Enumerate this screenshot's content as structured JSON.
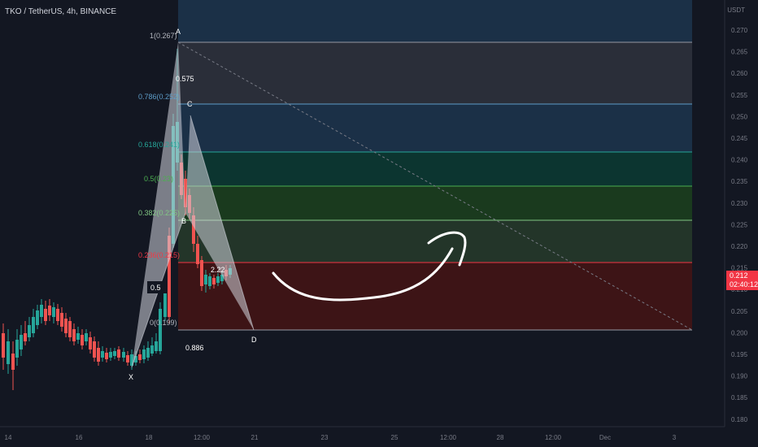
{
  "header": {
    "title": "TKO / TetherUS, 4h, BINANCE"
  },
  "price_axis": {
    "unit": "USDT",
    "ticks": [
      "0.270",
      "0.265",
      "0.260",
      "0.255",
      "0.250",
      "0.245",
      "0.240",
      "0.235",
      "0.230",
      "0.225",
      "0.220",
      "0.215",
      "0.210",
      "0.205",
      "0.200",
      "0.195",
      "0.190",
      "0.185",
      "0.180"
    ]
  },
  "time_axis": {
    "ticks": [
      "14",
      "16",
      "18",
      "12:00",
      "21",
      "23",
      "25",
      "12:00",
      "28",
      "12:00",
      "Dec",
      "3"
    ]
  },
  "last_price": {
    "value": "0.212",
    "countdown": "02:40:12"
  },
  "fib_levels": [
    {
      "label": "1(0.267)",
      "color": "#9598a1",
      "fill": "#2a2e39"
    },
    {
      "label": "0.786(0.252)",
      "color": "#5d9cc8",
      "fill": "#1b3047"
    },
    {
      "label": "0.618(0.241)",
      "color": "#26a69a",
      "fill": "#0c3530"
    },
    {
      "label": "0.5(0.23)",
      "color": "#4caf50",
      "fill": "#1a3a1e"
    },
    {
      "label": "0.382(0.225)",
      "color": "#81c784",
      "fill": "#233529"
    },
    {
      "label": "0.236(0.215)",
      "color": "#f23645",
      "fill": "#3d1416"
    },
    {
      "label": "0(0.199)",
      "color": "#9598a1",
      "fill": ""
    }
  ],
  "pattern": {
    "points": [
      "X",
      "A",
      "B",
      "C",
      "D"
    ],
    "ratios": [
      "0.575",
      "0.5",
      "2.22",
      "0.886"
    ]
  },
  "colors": {
    "up": "#26a69a",
    "down": "#ef5350",
    "background": "#131722",
    "top_band": "#1b3047"
  }
}
